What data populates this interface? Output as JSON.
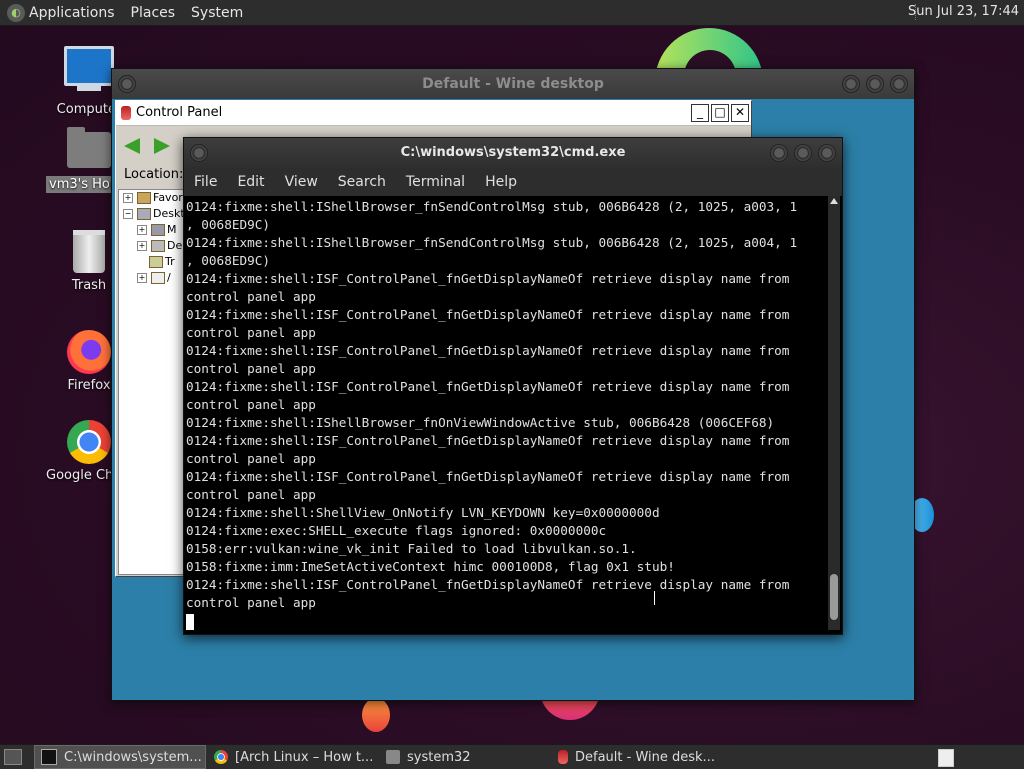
{
  "top_panel": {
    "menus": [
      "Applications",
      "Places",
      "System"
    ],
    "clock": "Sun Jul 23, 17:44"
  },
  "desktop_icons": [
    {
      "label": "Computer",
      "icon": "computer-icon"
    },
    {
      "label": "vm3's Home",
      "icon": "home-folder-icon"
    },
    {
      "label": "Trash",
      "icon": "trash-icon"
    },
    {
      "label": "Firefox",
      "icon": "firefox-icon"
    },
    {
      "label": "Google Chrome",
      "icon": "chrome-icon"
    }
  ],
  "wine_desktop": {
    "title": "Default - Wine desktop"
  },
  "control_panel": {
    "title": "Control Panel",
    "location_label": "Location:",
    "tree": [
      "Favor",
      "Deskto",
      "M",
      "De",
      "Tr",
      "/"
    ]
  },
  "cmd": {
    "title": "C:\\windows\\system32\\cmd.exe",
    "menu": [
      "File",
      "Edit",
      "View",
      "Search",
      "Terminal",
      "Help"
    ],
    "lines": [
      "0124:fixme:shell:IShellBrowser_fnSendControlMsg stub, 006B6428 (2, 1025, a003, 1",
      ", 0068ED9C)",
      "0124:fixme:shell:IShellBrowser_fnSendControlMsg stub, 006B6428 (2, 1025, a004, 1",
      ", 0068ED9C)",
      "0124:fixme:shell:ISF_ControlPanel_fnGetDisplayNameOf retrieve display name from",
      "control panel app",
      "0124:fixme:shell:ISF_ControlPanel_fnGetDisplayNameOf retrieve display name from",
      "control panel app",
      "0124:fixme:shell:ISF_ControlPanel_fnGetDisplayNameOf retrieve display name from",
      "control panel app",
      "0124:fixme:shell:ISF_ControlPanel_fnGetDisplayNameOf retrieve display name from",
      "control panel app",
      "0124:fixme:shell:IShellBrowser_fnOnViewWindowActive stub, 006B6428 (006CEF68)",
      "0124:fixme:shell:ISF_ControlPanel_fnGetDisplayNameOf retrieve display name from",
      "control panel app",
      "0124:fixme:shell:ISF_ControlPanel_fnGetDisplayNameOf retrieve display name from",
      "control panel app",
      "0124:fixme:shell:ShellView_OnNotify LVN_KEYDOWN key=0x0000000d",
      "0124:fixme:exec:SHELL_execute flags ignored: 0x0000000c",
      "0158:err:vulkan:wine_vk_init Failed to load libvulkan.so.1.",
      "0158:fixme:imm:ImeSetActiveContext himc 000100D8, flag 0x1 stub!",
      "0124:fixme:shell:ISF_ControlPanel_fnGetDisplayNameOf retrieve display name from",
      "control panel app"
    ]
  },
  "taskbar": {
    "items": [
      {
        "label": "C:\\windows\\system...",
        "icon": "terminal-icon",
        "active": true
      },
      {
        "label": "[Arch Linux – How t...",
        "icon": "chrome-icon",
        "active": false
      },
      {
        "label": "system32",
        "icon": "folder-icon",
        "active": false
      },
      {
        "label": "Default - Wine desk...",
        "icon": "wine-icon",
        "active": false
      }
    ]
  }
}
